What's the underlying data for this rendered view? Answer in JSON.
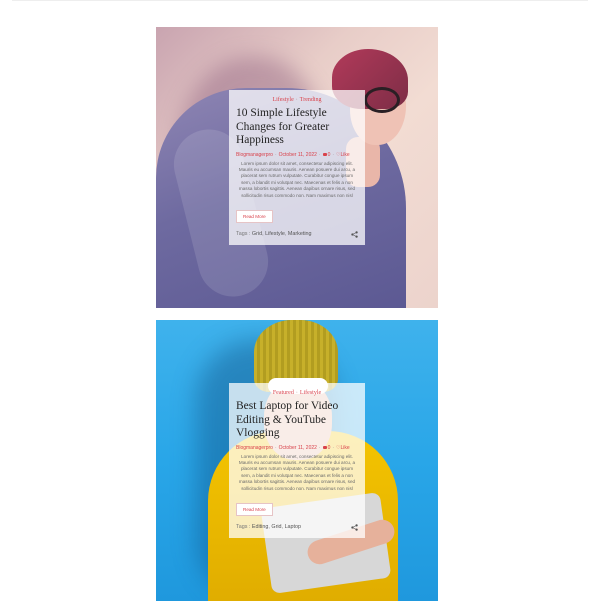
{
  "colors": {
    "accent": "#d9424b",
    "card_bg": "rgba(255,255,255,0.74)"
  },
  "posts": [
    {
      "categories": [
        "Lifestyle",
        "Trending"
      ],
      "title": "10 Simple Lifestyle Changes for Greater Happiness",
      "author": "Blogmanagerpro",
      "date": "October 11, 2022",
      "comments": "0",
      "likes": "Like",
      "excerpt": "Lorem ipsum dolor sit amet, consectetur adipiscing elit. Mauris eu accumsan mauris. Aenean posuere dui arcu, a placerat sem rutrum vulputate. Curabitur congue ipsum sem, a blandit mi volutpat nec. Maecenas et felis a non massa lobortis sagittis. Aenean dapibus ornare risus, sed sollicitudin risus commodo non. Nam maximus non nisl",
      "read_more": "Read More",
      "tags_label": "Tags :",
      "tags": [
        "Grid",
        "Lifestyle",
        "Marketing"
      ],
      "photo": "woman-with-glasses-photo"
    },
    {
      "categories": [
        "Featured",
        "Lifestyle"
      ],
      "title": "Best Laptop for Video Editing & YouTube Vlogging",
      "author": "Blogmanagerpro",
      "date": "October 11, 2022",
      "comments": "0",
      "likes": "Like",
      "excerpt": "Lorem ipsum dolor sit amet, consectetur adipiscing elit. Mauris eu accumsan mauris. Aenean posuere dui arcu, a placerat sem rutrum vulputate. Curabitur congue ipsum sem, a blandit mi volutpat nec. Maecenas et felis a non massa lobortis sagittis. Aenean dapibus ornare risus, sed sollicitudin risus commodo non. Nam maximus non nisl",
      "read_more": "Read More",
      "tags_label": "Tags :",
      "tags": [
        "Editing",
        "Grid",
        "Laptop"
      ],
      "photo": "yellow-beanie-laptop-photo"
    }
  ]
}
